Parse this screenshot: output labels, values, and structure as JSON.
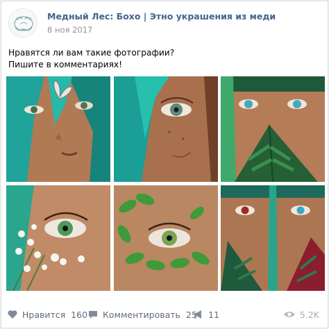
{
  "post": {
    "author": "Медный Лес: Бохо | Этно украшения из меди",
    "date": "8 ноя 2017",
    "text_lines": [
      "Нравятся ли вам такие фотографии?",
      "Пишите в комментариях!"
    ],
    "photos": [
      {
        "subject": "face-butterfly-teal-hair"
      },
      {
        "subject": "face-eye-teal-hair"
      },
      {
        "subject": "face-fern-blue-eyes"
      },
      {
        "subject": "eye-white-flowers"
      },
      {
        "subject": "eye-green-leaves"
      },
      {
        "subject": "twins-red-fern"
      }
    ]
  },
  "footer": {
    "like_label": "Нравится",
    "like_count": "160",
    "comment_label": "Комментировать",
    "comment_count": "25",
    "share_count": "11",
    "views_count": "5.2K"
  },
  "colors": {
    "author": "#42648b",
    "action": "#5f6c7a",
    "muted": "#939393"
  },
  "icons": [
    "like-heart-icon",
    "comment-bubble-icon",
    "share-megaphone-icon",
    "views-eye-icon"
  ]
}
